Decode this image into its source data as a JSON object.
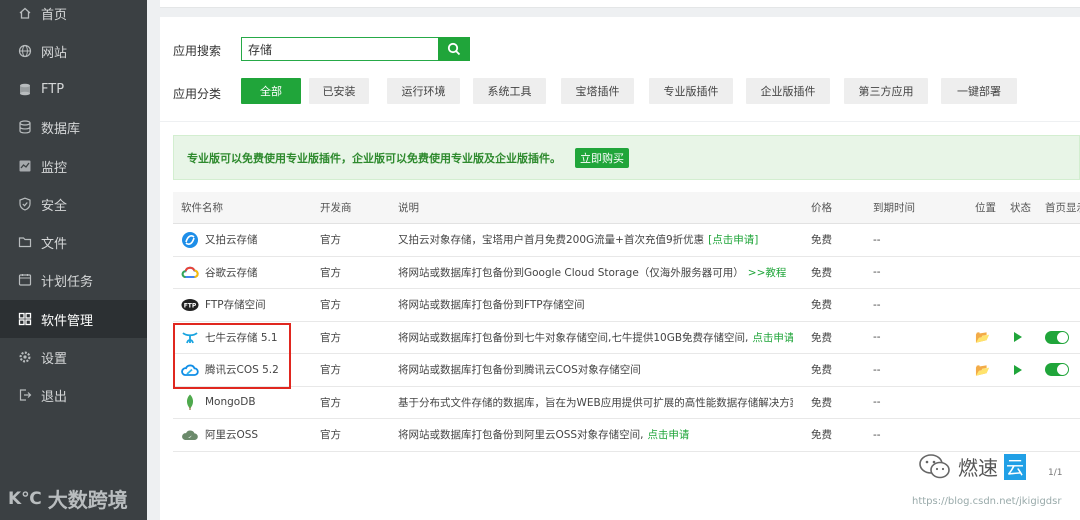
{
  "sidebar": {
    "items": [
      {
        "label": "首页",
        "icon": "home-icon"
      },
      {
        "label": "网站",
        "icon": "globe-icon"
      },
      {
        "label": "FTP",
        "icon": "ftp-icon"
      },
      {
        "label": "数据库",
        "icon": "database-icon"
      },
      {
        "label": "监控",
        "icon": "monitor-icon"
      },
      {
        "label": "安全",
        "icon": "shield-icon"
      },
      {
        "label": "文件",
        "icon": "folder-icon"
      },
      {
        "label": "计划任务",
        "icon": "clock-icon"
      },
      {
        "label": "软件管理",
        "icon": "grid-icon"
      },
      {
        "label": "设置",
        "icon": "gear-icon"
      },
      {
        "label": "退出",
        "icon": "logout-icon"
      }
    ],
    "active_index": 8,
    "brand": "大数跨境",
    "brand_logo": "K℃"
  },
  "search": {
    "label": "应用搜索",
    "value": "存储"
  },
  "categories": {
    "label": "应用分类",
    "items": [
      "全部",
      "已安装",
      "运行环境",
      "系统工具",
      "宝塔插件",
      "专业版插件",
      "企业版插件",
      "第三方应用",
      "一键部署"
    ],
    "active_index": 0
  },
  "notice": {
    "text": "专业版可以免费使用专业版插件，企业版可以免费使用专业版及企业版插件。",
    "button": "立即购买"
  },
  "table": {
    "headers": {
      "name": "软件名称",
      "dev": "开发商",
      "desc": "说明",
      "price": "价格",
      "expire": "到期时间",
      "position": "位置",
      "status": "状态",
      "home": "首页显示"
    },
    "rows": [
      {
        "name": "又拍云存储",
        "icon": "upyun-icon",
        "dev": "官方",
        "desc": "又拍云对象存储，宝塔用户首月免费200G流量+首次充值9折优惠",
        "link": "[点击申请]",
        "price": "免费",
        "expire": "--",
        "installed": false
      },
      {
        "name": "谷歌云存储",
        "icon": "google-cloud-icon",
        "dev": "官方",
        "desc": "将网站或数据库打包备份到Google Cloud Storage（仅海外服务器可用）",
        "link": ">>教程",
        "price": "免费",
        "expire": "--",
        "installed": false
      },
      {
        "name": "FTP存储空间",
        "icon": "ftp-storage-icon",
        "dev": "官方",
        "desc": "将网站或数据库打包备份到FTP存储空间",
        "link": "",
        "price": "免费",
        "expire": "--",
        "installed": false
      },
      {
        "name": "七牛云存储 5.1",
        "icon": "qiniu-icon",
        "dev": "官方",
        "desc": "将网站或数据库打包备份到七牛对象存储空间,七牛提供10GB免费存储空间,",
        "link": "点击申请",
        "price": "免费",
        "expire": "--",
        "installed": true
      },
      {
        "name": "腾讯云COS 5.2",
        "icon": "tencent-cloud-icon",
        "dev": "官方",
        "desc": "将网站或数据库打包备份到腾讯云COS对象存储空间",
        "link": "",
        "price": "免费",
        "expire": "--",
        "installed": true
      },
      {
        "name": "MongoDB",
        "icon": "mongodb-leaf-icon",
        "dev": "官方",
        "desc": "基于分布式文件存储的数据库，旨在为WEB应用提供可扩展的高性能数据存储解决方案!",
        "link": "",
        "price": "免费",
        "expire": "--",
        "installed": false
      },
      {
        "name": "阿里云OSS",
        "icon": "aliyun-oss-icon",
        "dev": "官方",
        "desc": "将网站或数据库打包备份到阿里云OSS对象存储空间,",
        "link": "点击申请",
        "price": "免费",
        "expire": "--",
        "installed": false
      }
    ]
  },
  "pager": "1/1",
  "watermark": {
    "text": "燃速",
    "cloud": "云",
    "url": "https://blog.csdn.net/jkigigdsr"
  },
  "colors": {
    "accent": "#20a53a",
    "sidebar_bg": "#3b4043",
    "highlight_border": "#e0271f"
  }
}
